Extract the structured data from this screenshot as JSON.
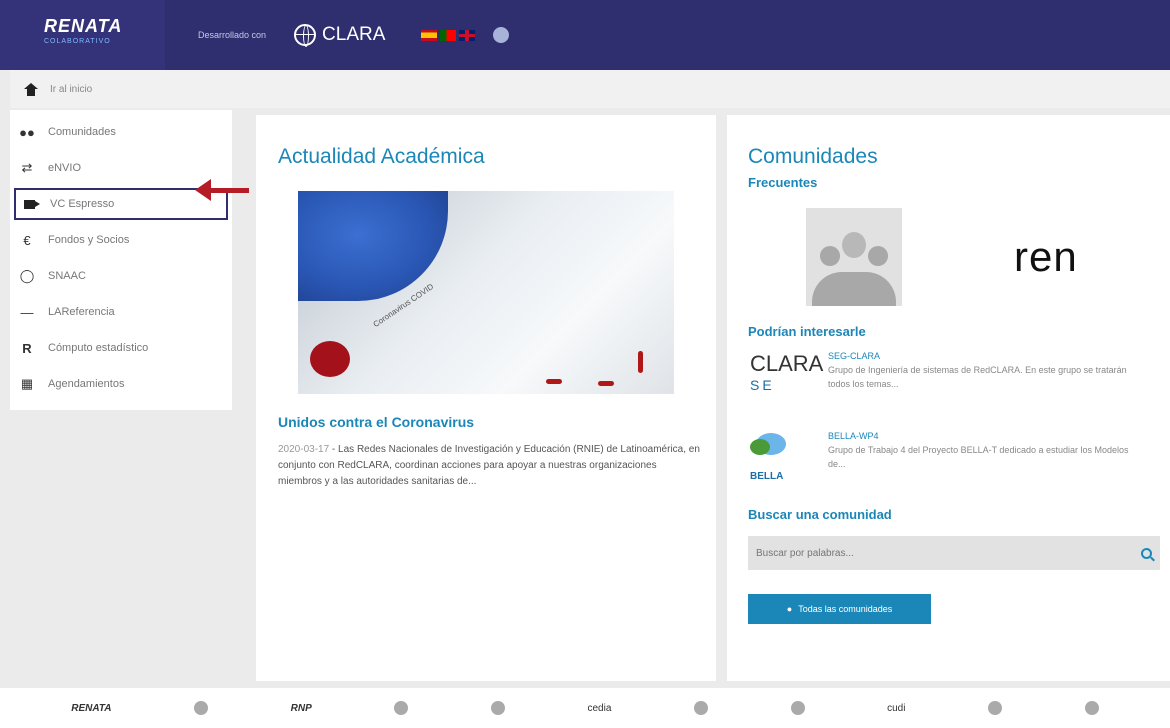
{
  "header": {
    "brand": "RENATA",
    "brand_sub": "COLABORATIVO",
    "developed_by": "Desarrollado con",
    "partner": "CLARA"
  },
  "homebar": {
    "label": "Ir al inicio"
  },
  "sidebar": {
    "items": [
      {
        "label": "Comunidades",
        "icon": "people-icon"
      },
      {
        "label": "eNVIO",
        "icon": "transfer-icon"
      },
      {
        "label": "VC Espresso",
        "icon": "video-camera-icon"
      },
      {
        "label": "Fondos y Socios",
        "icon": "funds-icon"
      },
      {
        "label": "SNAAC",
        "icon": "lock-icon"
      },
      {
        "label": "LAReferencia",
        "icon": "referencia-icon"
      },
      {
        "label": "Cómputo estadístico",
        "icon": "r-logo-icon"
      },
      {
        "label": "Agendamientos",
        "icon": "calendar-icon"
      }
    ]
  },
  "news": {
    "title": "Actualidad Académica",
    "image_label": "Coronavirus COVID",
    "headline": "Unidos contra el Coronavirus",
    "date": "2020-03-17",
    "body": " - Las Redes Nacionales de Investigación y Educación (RNIE) de Latinoamérica, en conjunto con RedCLARA, coordinan acciones para apoyar a nuestras organizaciones miembros y a las autoridades sanitarias de..."
  },
  "communities": {
    "title": "Comunidades",
    "frequent": "Frecuentes",
    "ren_logo": "ren",
    "suggested": "Podrían interesarle",
    "items": [
      {
        "logo": "CLARA",
        "logo_sub": "SE",
        "title": "SEG-CLARA",
        "desc": "Grupo de Ingeniería de sistemas de RedCLARA. En este grupo se tratarán todos los temas..."
      },
      {
        "logo": "BELLA",
        "title": "BELLA-WP4",
        "desc": "Grupo de Trabajo 4 del Proyecto BELLA-T dedicado a estudiar los Modelos de..."
      }
    ],
    "search_title": "Buscar una comunidad",
    "search_placeholder": "Buscar por palabras...",
    "all_button": "Todas las comunidades"
  },
  "footer": {
    "logos": [
      "RENATA",
      "RNP",
      "cedia",
      "cudi"
    ]
  }
}
